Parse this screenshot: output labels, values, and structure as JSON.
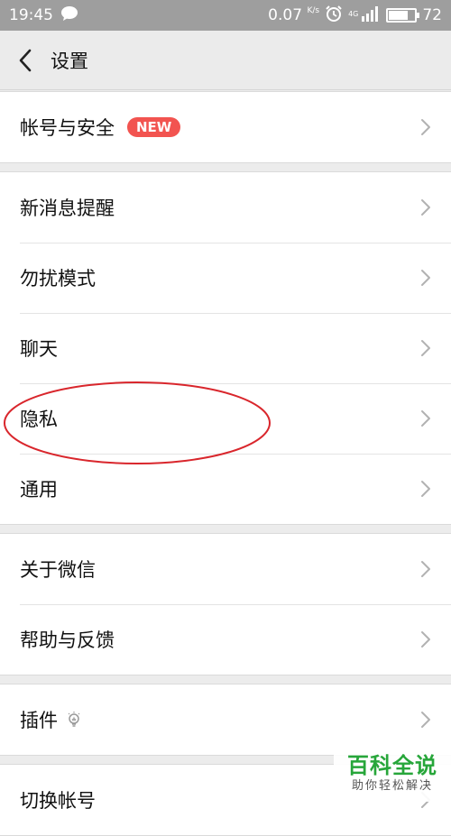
{
  "status_bar": {
    "time": "19:45",
    "net_speed": "0.07",
    "net_unit": "K/s",
    "network_type": "4G",
    "battery": "72",
    "battery_level_percent": 72,
    "icons": [
      "message-bubble-icon",
      "alarm-icon",
      "signal-icon",
      "battery-icon"
    ]
  },
  "header": {
    "title": "设置",
    "back_icon": "chevron-left-icon"
  },
  "groups": [
    {
      "items": [
        {
          "label": "帐号与安全",
          "badge": "NEW"
        }
      ]
    },
    {
      "items": [
        {
          "label": "新消息提醒"
        },
        {
          "label": "勿扰模式"
        },
        {
          "label": "聊天"
        },
        {
          "label": "隐私"
        },
        {
          "label": "通用"
        }
      ]
    },
    {
      "items": [
        {
          "label": "关于微信"
        },
        {
          "label": "帮助与反馈"
        }
      ]
    },
    {
      "items": [
        {
          "label": "插件",
          "icon": "lightbulb-icon"
        }
      ]
    },
    {
      "items": [
        {
          "label": "切换帐号"
        }
      ]
    }
  ],
  "annotation": {
    "color": "#d9262c"
  },
  "watermark": {
    "title": "百科全说",
    "subtitle": "助你轻松解决",
    "color": "#27a63a"
  },
  "colors": {
    "status_bar_bg": "#9e9e9e",
    "page_bg": "#ececec",
    "badge_bg": "#f25450",
    "chevron": "#b2b2b2"
  }
}
